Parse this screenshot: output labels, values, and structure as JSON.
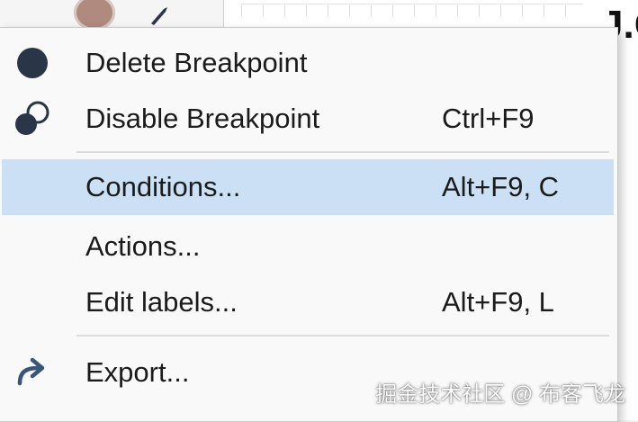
{
  "menu": {
    "items": [
      {
        "label": "Delete Breakpoint",
        "shortcut": "",
        "icon": "breakpoint-filled-icon"
      },
      {
        "label": "Disable Breakpoint",
        "shortcut": "Ctrl+F9",
        "icon": "breakpoint-disable-icon"
      },
      {
        "label": "Conditions...",
        "shortcut": "Alt+F9, C",
        "icon": "",
        "selected": true
      },
      {
        "label": "Actions...",
        "shortcut": "",
        "icon": ""
      },
      {
        "label": "Edit labels...",
        "shortcut": "Alt+F9, L",
        "icon": ""
      },
      {
        "label": "Export...",
        "shortcut": "",
        "icon": "export-arrow-icon"
      }
    ]
  },
  "background": {
    "heading_fragment": "J.C"
  },
  "watermark": "掘金技术社区 @ 布客飞龙",
  "colors": {
    "menu_bg": "#f9f9f9",
    "highlight": "#cce0f5",
    "icon": "#2b3548",
    "separator": "#dcdcdc"
  }
}
